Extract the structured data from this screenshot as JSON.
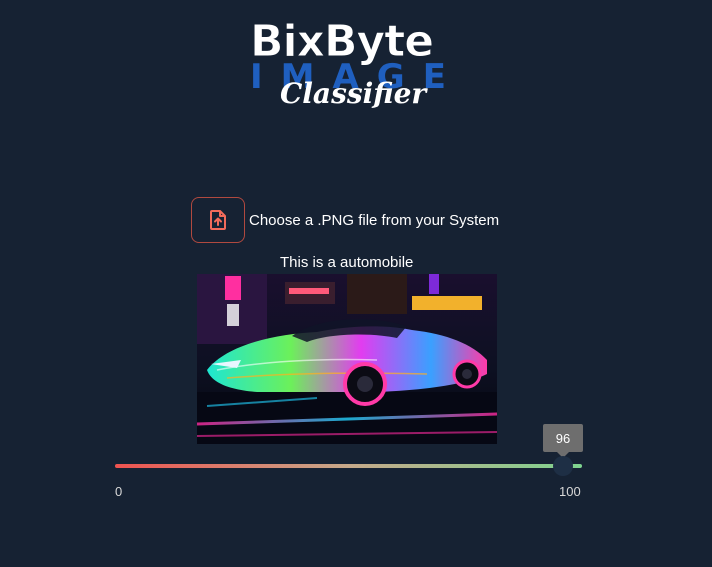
{
  "logo": {
    "brand": "BixByte",
    "image_word": "IMAGE",
    "subtitle": "Classifier"
  },
  "uploader": {
    "icon": "file-upload-icon",
    "label": "Choose a .PNG file from your System"
  },
  "prediction": {
    "text": "This is a automobile",
    "image_subject": "neon-lit sports car on a wet city street at night"
  },
  "confidence_slider": {
    "value": "96",
    "min_label": "0",
    "max_label": "100",
    "level": 0.96
  },
  "colors": {
    "background": "#162233",
    "upload_accent": "#f26b5b",
    "slider_start": "#ef5350",
    "slider_end": "#7ed48f",
    "logo_blue": "#1f5fbf"
  }
}
